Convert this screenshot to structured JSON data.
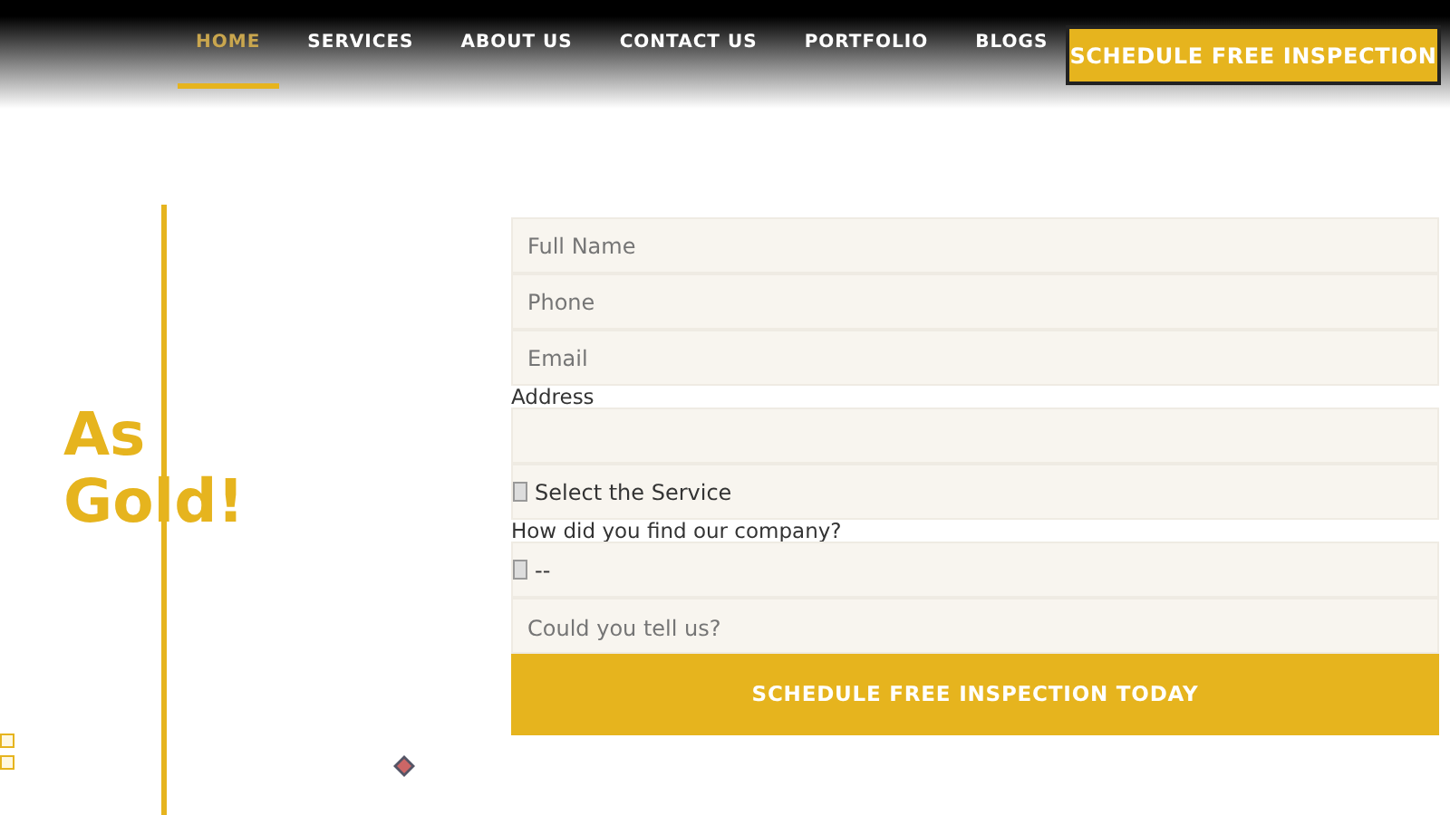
{
  "nav": {
    "items": [
      {
        "label": "HOME",
        "selected": true
      },
      {
        "label": "SERVICES",
        "selected": false
      },
      {
        "label": "ABOUT US",
        "selected": false
      },
      {
        "label": "CONTACT US",
        "selected": false
      },
      {
        "label": "PORTFOLIO",
        "selected": false
      },
      {
        "label": "BLOGS",
        "selected": false
      }
    ],
    "cta": "SCHEDULE FREE INSPECTION"
  },
  "hero": {
    "heading": "As Gold!"
  },
  "form": {
    "fields": [
      {
        "kind": "input",
        "placeholder": "Full Name"
      },
      {
        "kind": "input",
        "placeholder": "Phone"
      },
      {
        "kind": "input",
        "placeholder": "Email"
      },
      {
        "kind": "label",
        "text": "Address"
      },
      {
        "kind": "input"
      },
      {
        "kind": "select",
        "value": "Select the Service"
      },
      {
        "kind": "label",
        "text": "How did you find our company?"
      },
      {
        "kind": "select",
        "value": "--"
      },
      {
        "kind": "textarea",
        "placeholder": "Could you tell us?"
      }
    ],
    "submit": "SCHEDULE FREE INSPECTION TODAY"
  }
}
